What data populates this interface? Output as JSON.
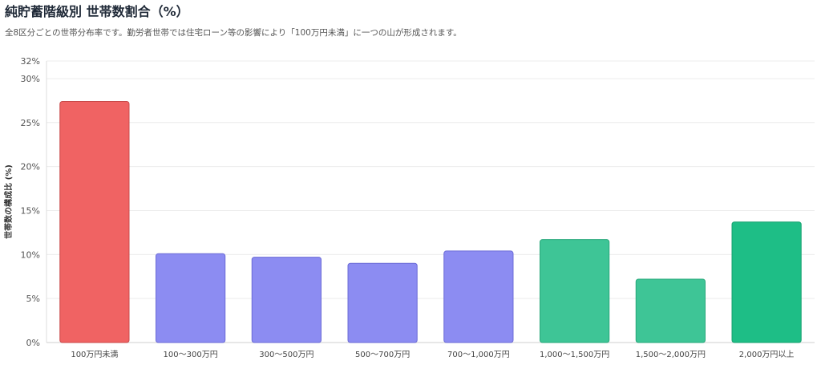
{
  "header": {
    "title": "純貯蓄階級別 世帯数割合（%）",
    "subtitle": "全8区分ごとの世帯分布率です。勤労者世帯では住宅ローン等の影響により「100万円未満」に一つの山が形成されます。"
  },
  "chart_data": {
    "type": "bar",
    "title": "純貯蓄階級別 世帯数割合（%）",
    "subtitle": "全8区分ごとの世帯分布率です。勤労者世帯では住宅ローン等の影響により「100万円未満」に一つの山が形成されます。",
    "xlabel": "",
    "ylabel": "世帯数の構成比 (%)",
    "ylim": [
      0,
      32
    ],
    "yticks": [
      {
        "value": 0,
        "label": "0%"
      },
      {
        "value": 5,
        "label": "5%"
      },
      {
        "value": 10,
        "label": "10%"
      },
      {
        "value": 15,
        "label": "15%"
      },
      {
        "value": 20,
        "label": "20%"
      },
      {
        "value": 25,
        "label": "25%"
      },
      {
        "value": 30,
        "label": "30%"
      },
      {
        "value": 32,
        "label": "32%"
      }
    ],
    "grid": true,
    "legend": "none",
    "categories": [
      "100万円未満",
      "100〜300万円",
      "300〜500万円",
      "500〜700万円",
      "700〜1,000万円",
      "1,000〜1,500万円",
      "1,500〜2,000万円",
      "2,000万円以上"
    ],
    "values": [
      27.4,
      10.1,
      9.7,
      9.0,
      10.4,
      11.7,
      7.2,
      13.7
    ],
    "colors": [
      "#f06363",
      "#8c8cf2",
      "#8c8cf2",
      "#8c8cf2",
      "#8c8cf2",
      "#3ec596",
      "#3ec596",
      "#1ebe86"
    ],
    "border_colors": [
      "#c94a4a",
      "#6b6bd6",
      "#6b6bd6",
      "#6b6bd6",
      "#6b6bd6",
      "#27a87a",
      "#27a87a",
      "#15a06f"
    ]
  }
}
